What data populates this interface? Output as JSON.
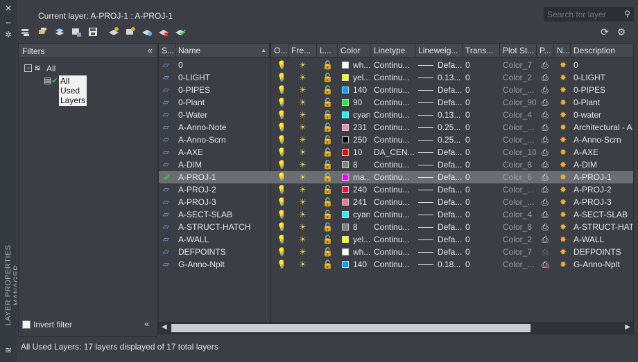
{
  "palette_title": "LAYER PROPERTIES MANAGER",
  "current_layer": "Current layer: A-PROJ-1 : A-PROJ-1",
  "search": {
    "placeholder": "Search for layer"
  },
  "filters": {
    "header": "Filters",
    "tree": [
      {
        "label": "All"
      },
      {
        "label": "All Used Layers"
      }
    ],
    "invert_label": "Invert filter"
  },
  "columns": [
    "S...",
    "Name",
    "O...",
    "Fre...",
    "L...",
    "Color",
    "Linetype",
    "Lineweig...",
    "Trans...",
    "Plot St...",
    "P...",
    "N...",
    "Description"
  ],
  "rows": [
    {
      "name": "0",
      "color_name": "wh...",
      "swatch": "#ffffff",
      "linetype": "Continu...",
      "lineweight": "Defa...",
      "trans": "0",
      "plot_style": "Color_7",
      "desc": "0"
    },
    {
      "name": "0-LIGHT",
      "color_name": "yel...",
      "swatch": "#ffff00",
      "linetype": "Continu...",
      "lineweight": "0.13...",
      "trans": "0",
      "plot_style": "Color_2",
      "desc": "0-LIGHT"
    },
    {
      "name": "0-PIPES",
      "color_name": "140",
      "swatch": "#00a5ff",
      "linetype": "Continu...",
      "lineweight": "Defa...",
      "trans": "0",
      "plot_style": "Color_...",
      "desc": "0-PIPES"
    },
    {
      "name": "0-Plant",
      "color_name": "90",
      "swatch": "#00ff22",
      "linetype": "Continu...",
      "lineweight": "Defa...",
      "trans": "0",
      "plot_style": "Color_90",
      "desc": "0-Plant"
    },
    {
      "name": "0-Water",
      "color_name": "cyan",
      "swatch": "#00ffff",
      "linetype": "Continu...",
      "lineweight": "0.13...",
      "trans": "0",
      "plot_style": "Color_4",
      "desc": "0-water"
    },
    {
      "name": "A-Anno-Note",
      "color_name": "231",
      "swatch": "#ea8fb4",
      "linetype": "Continu...",
      "lineweight": "0.25...",
      "trans": "0",
      "plot_style": "Color_...",
      "desc": "Architectural - A"
    },
    {
      "name": "A-Anno-Scrn",
      "color_name": "250",
      "swatch": "#000000",
      "linetype": "Continu...",
      "lineweight": "0.25...",
      "trans": "0",
      "plot_style": "Color_...",
      "desc": "A-Anno-Scrn"
    },
    {
      "name": "A-AXE",
      "color_name": "10",
      "swatch": "#ff0000",
      "linetype": "DA_CEN...",
      "lineweight": "Defa...",
      "trans": "0",
      "plot_style": "Color_10",
      "desc": "A-AXE"
    },
    {
      "name": "A-DIM",
      "color_name": "8",
      "swatch": "#808080",
      "linetype": "Continu...",
      "lineweight": "Defa...",
      "trans": "0",
      "plot_style": "Color_8",
      "desc": "A-DIM"
    },
    {
      "name": "A-PROJ-1",
      "color_name": "ma...",
      "swatch": "#ff00ff",
      "linetype": "Continu...",
      "lineweight": "Defa...",
      "trans": "0",
      "plot_style": "Color_6",
      "desc": "A-PROJ-1",
      "selected": true
    },
    {
      "name": "A-PROJ-2",
      "color_name": "240",
      "swatch": "#ff0040",
      "linetype": "Continu...",
      "lineweight": "Defa...",
      "trans": "0",
      "plot_style": "Color_...",
      "desc": "A-PROJ-2"
    },
    {
      "name": "A-PROJ-3",
      "color_name": "241",
      "swatch": "#ea7a8a",
      "linetype": "Continu...",
      "lineweight": "Defa...",
      "trans": "0",
      "plot_style": "Color_...",
      "desc": "A-PROJ-3"
    },
    {
      "name": "A-SECT-SLAB",
      "color_name": "cyan",
      "swatch": "#00ffff",
      "linetype": "Continu...",
      "lineweight": "Defa...",
      "trans": "0",
      "plot_style": "Color_4",
      "desc": "A-SECT-SLAB"
    },
    {
      "name": "A-STRUCT-HATCH",
      "color_name": "8",
      "swatch": "#808080",
      "linetype": "Continu...",
      "lineweight": "Defa...",
      "trans": "0",
      "plot_style": "Color_8",
      "desc": "A-STRUCT-HATC"
    },
    {
      "name": "A-WALL",
      "color_name": "yel...",
      "swatch": "#ffff00",
      "linetype": "Continu...",
      "lineweight": "Defa...",
      "trans": "0",
      "plot_style": "Color_2",
      "desc": "A-WALL"
    },
    {
      "name": "DEFPOINTS",
      "color_name": "wh...",
      "swatch": "#ffffff",
      "linetype": "Continu...",
      "lineweight": "Defa...",
      "trans": "0",
      "plot_style": "Color_7",
      "desc": "DEFPOINTS"
    },
    {
      "name": "G-Anno-Nplt",
      "color_name": "140",
      "swatch": "#00a5ff",
      "linetype": "Continu...",
      "lineweight": "0.18...",
      "trans": "0",
      "plot_style": "Color_...",
      "desc": "G-Anno-Nplt"
    }
  ],
  "status": "All Used Layers: 17 layers displayed of 17 total layers"
}
